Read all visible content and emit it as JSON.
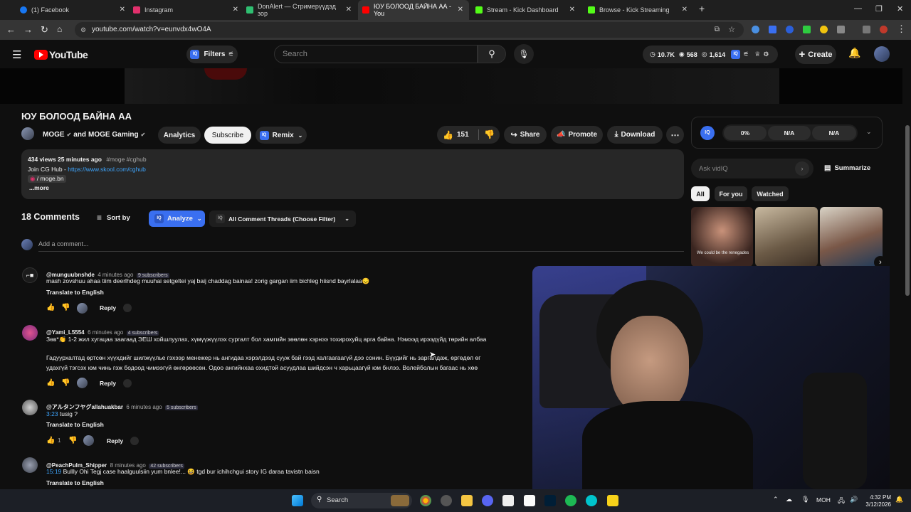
{
  "browser": {
    "tabs": [
      {
        "label": "(1) Facebook",
        "color": "#1877f2"
      },
      {
        "label": "Instagram",
        "color": "#e1306c"
      },
      {
        "label": "DonAlert — Стримерүүдэд зор",
        "color": "#2fbf71"
      },
      {
        "label": "ЮУ БОЛООД БАЙНА АА - You",
        "color": "#ff0000"
      },
      {
        "label": "Stream - Kick Dashboard",
        "color": "#53fc18"
      },
      {
        "label": "Browse - Kick Streaming",
        "color": "#53fc18"
      }
    ],
    "new_tab": "+",
    "url": "youtube.com/watch?v=eunvdx4wO4A"
  },
  "yt": {
    "logo": "YouTube",
    "filters": "Filters",
    "search_placeholder": "Search",
    "stats": {
      "views": "10.7K",
      "eyes": "568",
      "other": "1,614"
    },
    "create": "Create"
  },
  "video": {
    "title": "ЮУ БОЛООД БАЙНА АА",
    "channel": "MOGE",
    "and_text": "and",
    "channel2": "MOGE Gaming",
    "analytics": "Analytics",
    "subscribe": "Subscribe",
    "remix": "Remix",
    "likes": "151",
    "share": "Share",
    "promote": "Promote",
    "download": "Download"
  },
  "description": {
    "meta": "434 views  25 minutes ago",
    "tags": "#moge #cghub",
    "join": "Join CG Hub - ",
    "link": "https://www.skool.com/cghub",
    "insta": "/ moge.bn",
    "more": "...more"
  },
  "comments": {
    "count_label": "18 Comments",
    "sort": "Sort by",
    "analyze": "Analyze",
    "filter": "All Comment Threads (Choose Filter)",
    "add_placeholder": "Add a comment...",
    "reply": "Reply",
    "translate": "Translate to English",
    "items": [
      {
        "user": "@munguubnshde",
        "time": "4 minutes ago",
        "subs": "9 subscribers",
        "line1": "mash zovshuu ahaa tiim deerlhdeg muuhai setgeltei yaj baij chaddag bainaa! zorig gargan iim bichleg hiisnd bayrlalaa😔"
      },
      {
        "user": "@Yami_L5554",
        "time": "6 minutes ago",
        "subs": "4 subscribers",
        "line1": "Зөв*👏 1-2 жил хугацаа заагаад ЭЕШ хойшлуулах, хүмүүжүүлэх сургалт бол хамгийн зөөлөн хэрнээ тохирохуйц арга байна. Нэмээд ирээдүйд төрийн албаа",
        "line2": "Гадуурхалтад өртсөн хүүхдийг шилжүүлье гэхээр менежер нь ангидаа хэрэлдээд сууж бай гээд халгаагаагүй дээ сонин. Бүүдийг нь заргалдаж, өргөдөл өг",
        "line3": "удахгүй тэгсэх юм чинь гэж бодоод чимээгүй өнгөрөөсөн. Одоо   ангийнхаа охидтой асуудлаа шийдсэн ч харьцаагүй юм бнлээ. Волейболын багаас нь хөө"
      },
      {
        "user": "@アルタンフヤグallahuakbar",
        "time": "6 minutes ago",
        "subs": "5 subscribers",
        "stamp": "3:23",
        "line1": " tusig ?",
        "likes": "1"
      },
      {
        "user": "@PeachPulm_Shipper",
        "time": "8 minutes ago",
        "subs": "42 subscribers",
        "stamp": "15:19",
        "line1": " Bullly Ohi Tegj case haalguulsiin yum bnlee!... 😆 tgd  bur ichihchgui story IG daraa tavistn baisn"
      }
    ]
  },
  "sidebar": {
    "iq_stats": [
      "0%",
      "N/A",
      "N/A"
    ],
    "ask_placeholder": "Ask vidIQ",
    "summarize": "Summarize",
    "chips": [
      "All",
      "For you",
      "Watched"
    ],
    "thumb_caption": "We could be the renegades"
  },
  "taskbar": {
    "search": "Search",
    "lang": "МОН",
    "time": "4:32 PM",
    "date": "3/12/2026"
  }
}
